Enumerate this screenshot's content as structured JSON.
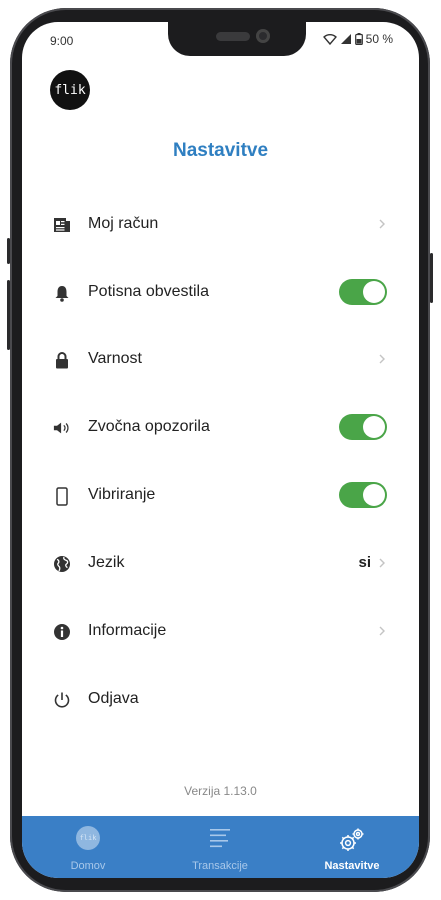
{
  "status_bar": {
    "time": "9:00",
    "battery": "50 %"
  },
  "header": {
    "logo_text": "flik",
    "title": "Nastavitve"
  },
  "settings": {
    "items": [
      {
        "label": "Moj račun",
        "icon": "newspaper-icon",
        "control": "chevron"
      },
      {
        "label": "Potisna obvestila",
        "icon": "bell-icon",
        "control": "toggle",
        "enabled": true
      },
      {
        "label": "Varnost",
        "icon": "lock-icon",
        "control": "chevron"
      },
      {
        "label": "Zvočna opozorila",
        "icon": "speaker-icon",
        "control": "toggle",
        "enabled": true
      },
      {
        "label": "Vibriranje",
        "icon": "phone-outline-icon",
        "control": "toggle",
        "enabled": true
      },
      {
        "label": "Jezik",
        "icon": "globe-icon",
        "control": "chevron",
        "value": "si"
      },
      {
        "label": "Informacije",
        "icon": "info-icon",
        "control": "chevron"
      },
      {
        "label": "Odjava",
        "icon": "power-icon",
        "control": "none"
      }
    ]
  },
  "footer": {
    "version": "Verzija 1.13.0"
  },
  "tab_bar": {
    "tabs": [
      {
        "label": "Domov",
        "icon": "flik-logo-icon",
        "logo_text": "flik",
        "active": false
      },
      {
        "label": "Transakcije",
        "icon": "list-lines-icon",
        "active": false
      },
      {
        "label": "Nastavitve",
        "icon": "gears-icon",
        "active": true
      }
    ]
  },
  "colors": {
    "accent": "#2f7fc1",
    "tab_bar": "#3a7fc6",
    "toggle_on": "#4aa548"
  }
}
